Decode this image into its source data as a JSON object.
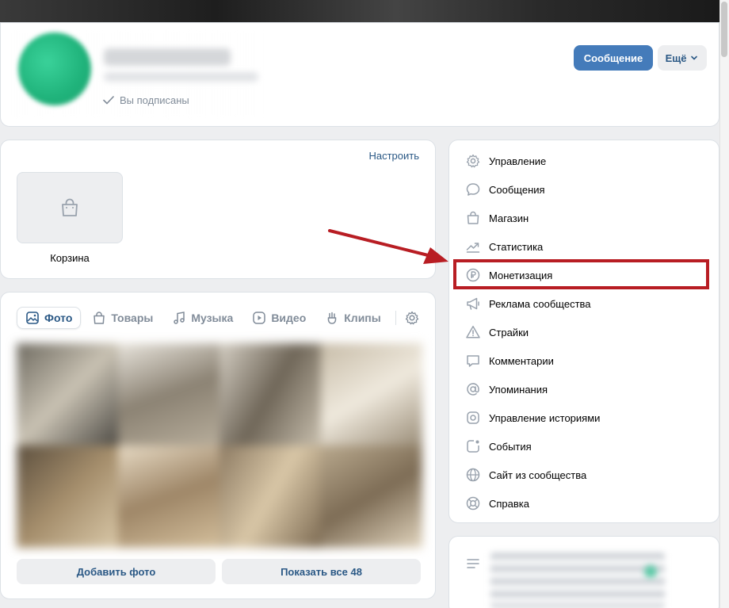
{
  "header": {
    "subscribed_label": "Вы подписаны",
    "message_button": "Сообщение",
    "more_button": "Ещё"
  },
  "cart": {
    "configure_link": "Настроить",
    "cart_label": "Корзина"
  },
  "media": {
    "tabs": [
      {
        "label": "Фото",
        "icon": "image-icon",
        "active": true
      },
      {
        "label": "Товары",
        "icon": "bag-icon",
        "active": false
      },
      {
        "label": "Музыка",
        "icon": "music-note-icon",
        "active": false
      },
      {
        "label": "Видео",
        "icon": "play-icon",
        "active": false
      },
      {
        "label": "Клипы",
        "icon": "clips-icon",
        "active": false
      }
    ],
    "add_photo_button": "Добавить фото",
    "show_all_button": "Показать все 48"
  },
  "menu": {
    "items": [
      {
        "label": "Управление",
        "icon": "gear-icon"
      },
      {
        "label": "Сообщения",
        "icon": "chat-bubble-icon"
      },
      {
        "label": "Магазин",
        "icon": "bag-icon"
      },
      {
        "label": "Статистика",
        "icon": "trend-chart-icon"
      },
      {
        "label": "Монетизация",
        "icon": "ruble-coin-icon"
      },
      {
        "label": "Реклама сообщества",
        "icon": "megaphone-icon"
      },
      {
        "label": "Страйки",
        "icon": "warning-triangle-icon"
      },
      {
        "label": "Комментарии",
        "icon": "comment-icon"
      },
      {
        "label": "Упоминания",
        "icon": "at-sign-icon"
      },
      {
        "label": "Управление историями",
        "icon": "stories-icon"
      },
      {
        "label": "События",
        "icon": "event-icon"
      },
      {
        "label": "Сайт из сообщества",
        "icon": "globe-icon"
      },
      {
        "label": "Справка",
        "icon": "help-lifebuoy-icon"
      }
    ]
  },
  "colors": {
    "accent": "#447bba",
    "link": "#2a5885",
    "muted": "#818c99",
    "highlight": "#b81d23",
    "background": "#edeef0"
  }
}
